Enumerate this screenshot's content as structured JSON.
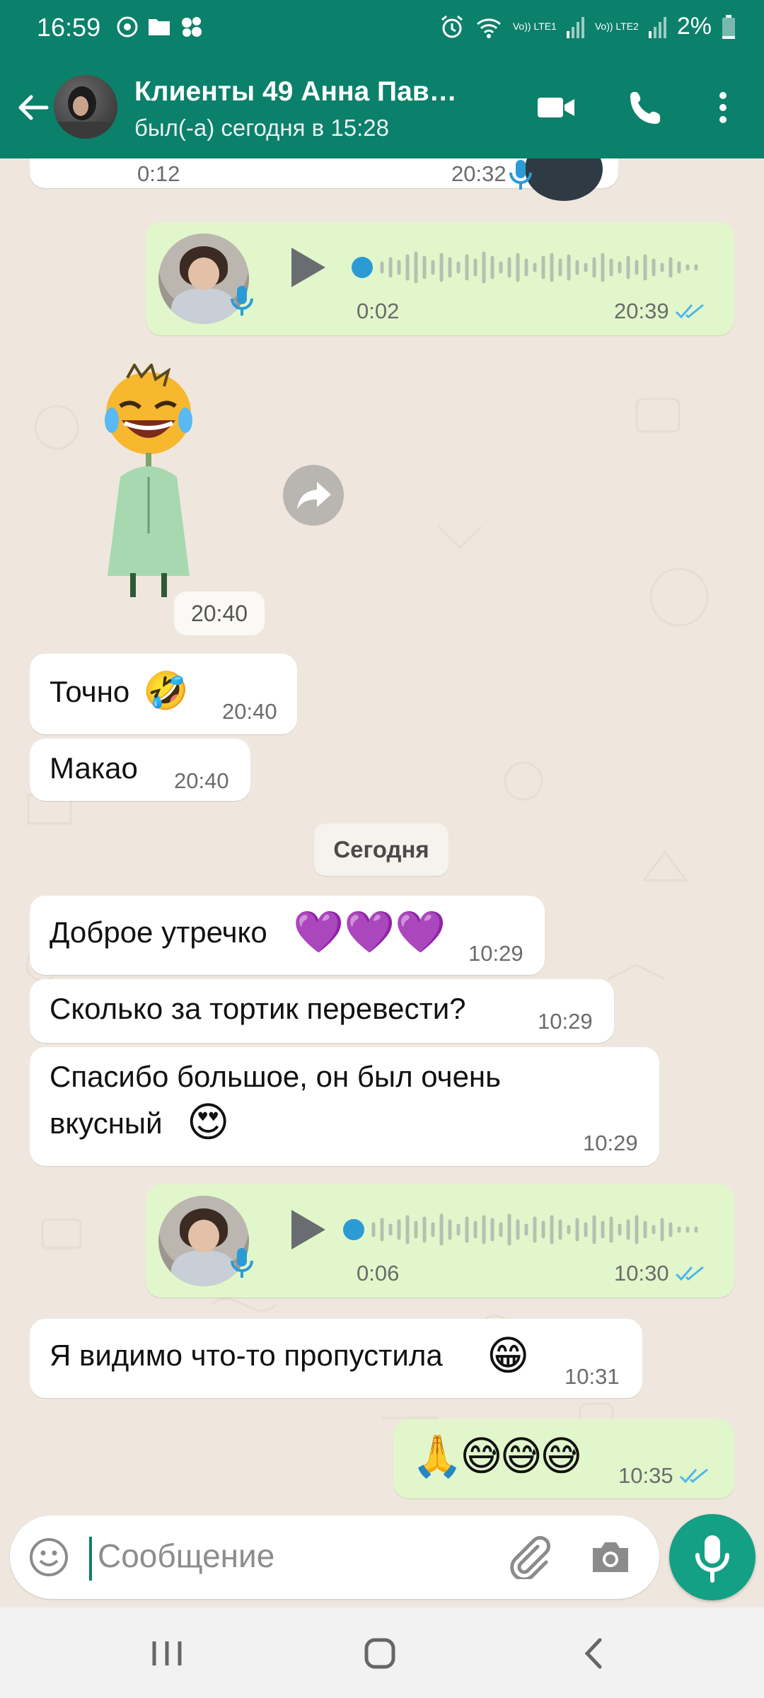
{
  "status_bar": {
    "time": "16:59",
    "battery": "2%",
    "sim1": "Vo)) LTE1",
    "sim2": "Vo)) LTE2"
  },
  "header": {
    "title": "Клиенты 49 Анна Пав…",
    "subtitle": "был(-а) сегодня в 15:28"
  },
  "messages": [
    {
      "kind": "voice_in_partial",
      "duration": "0:12",
      "time": "20:32"
    },
    {
      "kind": "voice_out",
      "duration": "0:02",
      "time": "20:39"
    },
    {
      "kind": "sticker_in",
      "time": "20:40"
    },
    {
      "kind": "text_in",
      "text": "Точно",
      "emoji": "🤣",
      "time": "20:40"
    },
    {
      "kind": "text_in",
      "text": "Макао",
      "time": "20:40"
    },
    {
      "kind": "date",
      "text": "Сегодня"
    },
    {
      "kind": "text_in",
      "text": "Доброе утречко",
      "emoji": "💜💜💜",
      "time": "10:29"
    },
    {
      "kind": "text_in",
      "text": "Сколько за тортик перевести?",
      "time": "10:29"
    },
    {
      "kind": "text_in",
      "line1": "Спасибо большое, он был очень",
      "line2": "вкусный",
      "emoji": "😍",
      "time": "10:29"
    },
    {
      "kind": "voice_out",
      "duration": "0:06",
      "time": "10:30"
    },
    {
      "kind": "text_in",
      "text": "Я видимо что-то пропустила",
      "emoji": "😁",
      "time": "10:31"
    },
    {
      "kind": "text_out",
      "emoji": "🙏😅😅😅",
      "time": "10:35"
    }
  ],
  "input": {
    "placeholder": "Сообщение"
  },
  "colors": {
    "header": "#0b806b",
    "outgoing_bubble": "#e1f7cb",
    "incoming_bubble": "#ffffff",
    "chat_background": "#efe7de",
    "read_ticks": "#4fb6ec",
    "mic_button": "#14a085"
  },
  "icons": [
    "back-arrow-icon",
    "video-call-icon",
    "phone-icon",
    "more-vert-icon",
    "mic-icon",
    "play-icon",
    "forward-icon",
    "emoji-icon",
    "attach-icon",
    "camera-icon",
    "double-check-icon"
  ]
}
